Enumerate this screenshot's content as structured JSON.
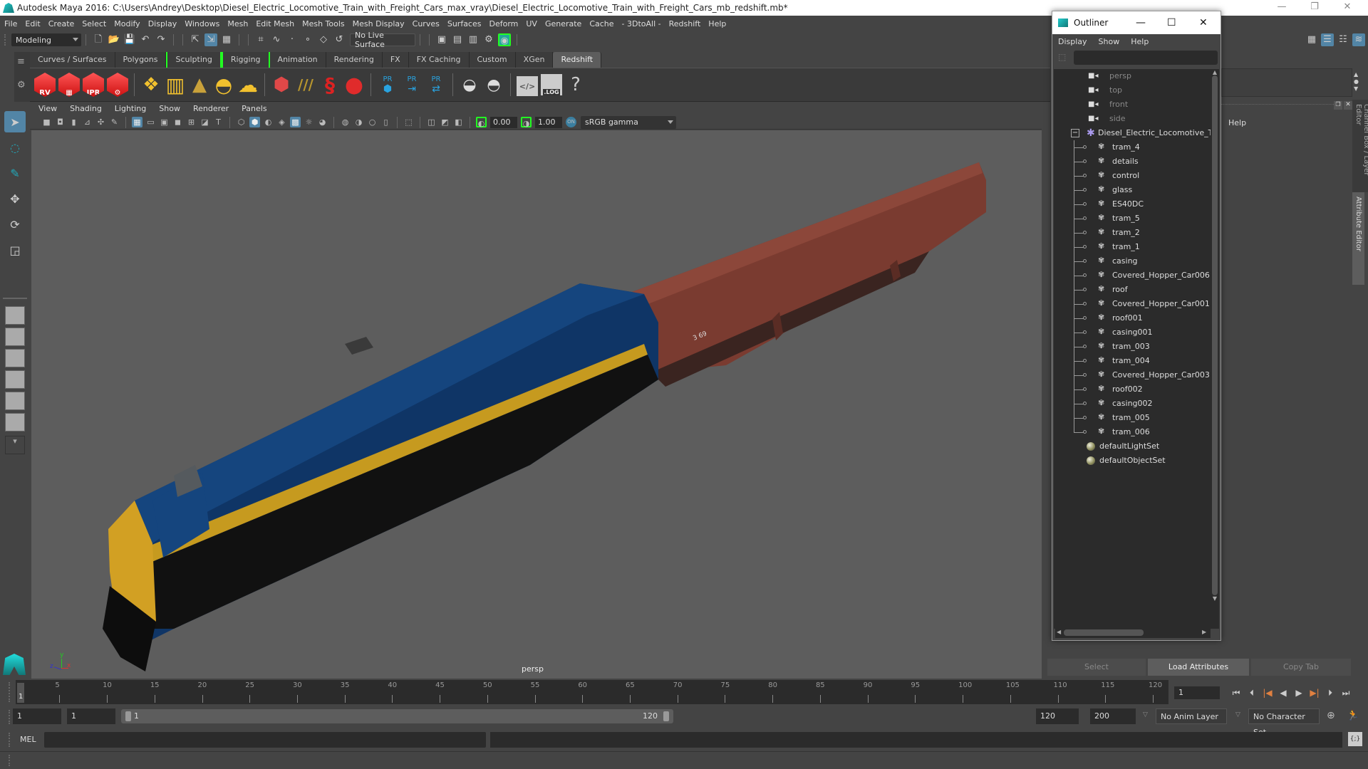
{
  "window": {
    "title": "Autodesk Maya 2016: C:\\Users\\Andrey\\Desktop\\Diesel_Electric_Locomotive_Train_with_Freight_Cars_max_vray\\Diesel_Electric_Locomotive_Train_with_Freight_Cars_mb_redshift.mb*",
    "controls": {
      "minimize": "—",
      "restore": "❐",
      "close": "✕"
    }
  },
  "menubar": [
    "File",
    "Edit",
    "Create",
    "Select",
    "Modify",
    "Display",
    "Windows",
    "Mesh",
    "Edit Mesh",
    "Mesh Tools",
    "Mesh Display",
    "Curves",
    "Surfaces",
    "Deform",
    "UV",
    "Generate",
    "Cache",
    "- 3DtoAll -",
    "Redshift",
    "Help"
  ],
  "statusline": {
    "mode": "Modeling",
    "live_surface": "No Live Surface"
  },
  "shelf": {
    "tabs": [
      {
        "label": "Curves / Surfaces"
      },
      {
        "label": "Polygons"
      },
      {
        "label": "Sculpting",
        "bracketed": true
      },
      {
        "label": "Rigging",
        "bracketed": true
      },
      {
        "label": "Animation"
      },
      {
        "label": "Rendering"
      },
      {
        "label": "FX"
      },
      {
        "label": "FX Caching"
      },
      {
        "label": "Custom"
      },
      {
        "label": "XGen"
      },
      {
        "label": "Redshift",
        "active": true
      }
    ],
    "icons": [
      {
        "name": "redshift-renderview-icon",
        "label": "RV"
      },
      {
        "name": "redshift-batch-render-icon",
        "label": ""
      },
      {
        "name": "redshift-ipr-icon",
        "label": "IPR"
      },
      {
        "name": "redshift-settings-icon",
        "label": ""
      },
      {
        "name": "redshift-area-light-icon",
        "label": ""
      },
      {
        "name": "redshift-portal-light-icon",
        "label": ""
      },
      {
        "name": "redshift-spot-light-icon",
        "label": ""
      },
      {
        "name": "redshift-dome-light-icon",
        "label": ""
      },
      {
        "name": "redshift-sun-sky-icon",
        "label": ""
      },
      {
        "name": "redshift-proxy-icon",
        "label": ""
      },
      {
        "name": "redshift-hair-icon",
        "label": ""
      },
      {
        "name": "redshift-material-icon",
        "label": ""
      },
      {
        "name": "redshift-sphere-material-icon",
        "label": ""
      },
      {
        "name": "redshift-proxy-create-icon",
        "label": "PR"
      },
      {
        "name": "redshift-proxy-export-icon",
        "label": "PR"
      },
      {
        "name": "redshift-proxy-swap-icon",
        "label": "PR"
      },
      {
        "name": "redshift-bake-multi-icon",
        "label": ""
      },
      {
        "name": "redshift-bake-icon",
        "label": ""
      },
      {
        "name": "redshift-script-icon",
        "label": ""
      },
      {
        "name": "redshift-log-icon",
        "label": ".LOG"
      },
      {
        "name": "help-icon",
        "label": "?"
      }
    ]
  },
  "panel": {
    "menus": [
      "View",
      "Shading",
      "Lighting",
      "Show",
      "Renderer",
      "Panels"
    ],
    "exposure": "0.00",
    "gamma": "1.00",
    "color_space": "sRGB gamma",
    "camera_label": "persp"
  },
  "outliner": {
    "title": "Outliner",
    "menus": [
      "Display",
      "Show",
      "Help"
    ],
    "cameras": [
      "persp",
      "top",
      "front",
      "side"
    ],
    "root": "Diesel_Electric_Locomotive_Trai",
    "children": [
      "tram_4",
      "details",
      "control",
      "glass",
      "ES40DC",
      "tram_5",
      "tram_2",
      "tram_1",
      "casing",
      "Covered_Hopper_Car006",
      "roof",
      "Covered_Hopper_Car001",
      "roof001",
      "casing001",
      "tram_003",
      "tram_004",
      "Covered_Hopper_Car003",
      "roof002",
      "casing002",
      "tram_005",
      "tram_006"
    ],
    "sets": [
      "defaultLightSet",
      "defaultObjectSet"
    ]
  },
  "attribute_editor": {
    "help_label": "Help",
    "side_tabs": [
      "Channel Box / Layer Editor",
      "Attribute Editor"
    ],
    "buttons": [
      "Select",
      "Load Attributes",
      "Copy Tab"
    ]
  },
  "timeline": {
    "start": 1,
    "end": 120,
    "step": 5,
    "current_frame": "1",
    "range_start": "1",
    "playback_start": "1",
    "slider_start_label": "1",
    "slider_end_label": "120",
    "playback_end": "120",
    "anim_end": "200",
    "anim_layer": "No Anim Layer",
    "character_set": "No Character Set"
  },
  "cmdline": {
    "label": "MEL"
  },
  "colors": {
    "accent": "#5285a6",
    "redshift_red": "#e02b2b",
    "light_yellow": "#f2c12e",
    "proxy_blue": "#29a3e0",
    "bracket_green": "#22ee22"
  }
}
